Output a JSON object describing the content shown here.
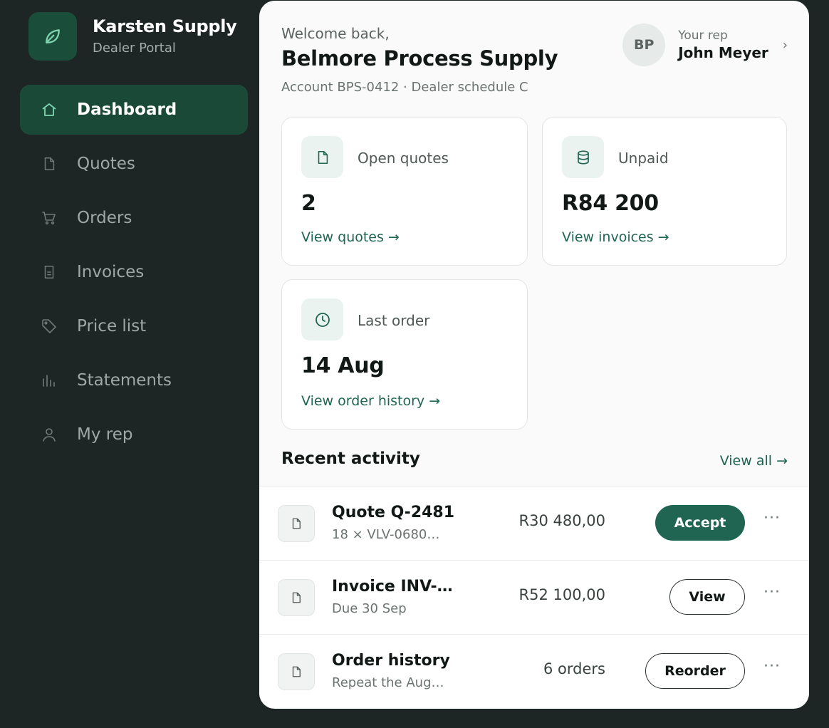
{
  "brand": {
    "name": "Karsten Supply",
    "subtitle": "Dealer Portal"
  },
  "nav": [
    {
      "label": "Dashboard",
      "icon": "home-icon",
      "active": true
    },
    {
      "label": "Quotes",
      "icon": "document-icon"
    },
    {
      "label": "Orders",
      "icon": "cart-icon"
    },
    {
      "label": "Invoices",
      "icon": "invoice-icon"
    },
    {
      "label": "Price list",
      "icon": "tag-icon"
    },
    {
      "label": "Statements",
      "icon": "bar-chart-icon"
    },
    {
      "label": "My rep",
      "icon": "user-icon"
    }
  ],
  "header": {
    "welcome": "Welcome back,",
    "account_name": "Belmore Process Supply",
    "account_meta": "Account BPS-0412 · Dealer schedule C"
  },
  "rep": {
    "initials": "BP",
    "label": "Your rep",
    "name": "John Meyer",
    "chevron": "›"
  },
  "stats": [
    {
      "label": "Open quotes",
      "value": "2",
      "link": "View quotes  →",
      "icon": "document-icon"
    },
    {
      "label": "Unpaid",
      "value": "R84 200",
      "link": "View invoices  →",
      "icon": "database-icon"
    },
    {
      "label": "Last order",
      "value": "14 Aug",
      "link": "View order history  →",
      "icon": "clock-icon"
    }
  ],
  "activity": {
    "title": "Recent activity",
    "view_all": "View all →",
    "rows": [
      {
        "title": "Quote Q-2481",
        "subtitle": "18 × VLV-0680…",
        "amount": "R30 480,00",
        "action": "Accept"
      },
      {
        "title": "Invoice INV-…",
        "subtitle": "Due 30 Sep",
        "amount": "R52 100,00",
        "action": "View"
      },
      {
        "title": "Order history",
        "subtitle": "Repeat the Aug…",
        "amount": "6 orders",
        "action": "Reorder"
      }
    ],
    "more": "···"
  },
  "colors": {
    "accent": "#1f6552",
    "sidebar_bg": "#1d2624",
    "active_nav": "#1a4a37"
  }
}
